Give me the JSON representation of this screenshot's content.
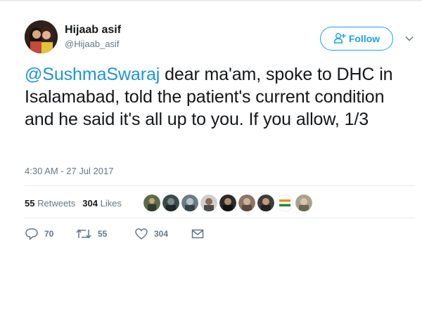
{
  "author": {
    "name": "Hijaab asif",
    "handle": "@Hijaab_asif"
  },
  "follow_button": {
    "label": "Follow",
    "icon": "add-user-icon"
  },
  "tweet": {
    "mention": "@SushmaSwaraj",
    "text": " dear ma'am, spoke to DHC in Isalamabad, told the patient's current condition and he said it's all up to you. If you allow, 1/3",
    "timestamp": "4:30 AM - 27 Jul 2017"
  },
  "stats": {
    "retweets_count": "55",
    "retweets_label": "Retweets",
    "likes_count": "304",
    "likes_label": "Likes"
  },
  "liker_avatars": [
    "avatar-1",
    "avatar-2",
    "avatar-3",
    "avatar-4",
    "avatar-5",
    "avatar-6",
    "avatar-7",
    "avatar-8",
    "avatar-9"
  ],
  "actions": {
    "replies": "70",
    "retweets": "55",
    "likes": "304"
  },
  "colors": {
    "accent": "#1da1f2",
    "mention": "#1b95e0",
    "muted": "#657786"
  }
}
